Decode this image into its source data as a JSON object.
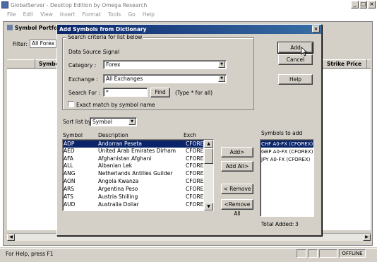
{
  "app": {
    "title": "GlobalServer - Desktop Edition by Omega Research",
    "window_buttons": [
      "_",
      "□",
      "×"
    ]
  },
  "menu": [
    "File",
    "Edit",
    "View",
    "Insert",
    "Format",
    "Tools",
    "Go",
    "Help"
  ],
  "child": {
    "title": "Symbol Portfo",
    "filter_label": "Filter:",
    "filter_value": "All Forex",
    "columns": [
      "Symbo",
      "Strike Price"
    ]
  },
  "dialog": {
    "title": "Add Symbols from Dictionary",
    "close": "×",
    "group_label": "Search criteria for list below",
    "data_source_label": "Data Source :",
    "data_source_value": "Signal",
    "category_label": "Category :",
    "category_value": "Forex",
    "exchange_label": "Exchange :",
    "exchange_value": "All Exchanges",
    "search_label": "Search For :",
    "search_value": "*",
    "find_button": "Find",
    "search_hint": "(Type * for all)",
    "exact_match_label": "Exact match by symbol name",
    "sort_label": "Sort list by",
    "sort_value": "Symbol",
    "list_headers": [
      "Symbol",
      "Description",
      "Exch"
    ],
    "symbols": [
      {
        "symbol": "ADP",
        "description": "Andorran Peseta",
        "exch": "CFOREX"
      },
      {
        "symbol": "AED",
        "description": "United Arab Emirates Dirham",
        "exch": "CFOREX"
      },
      {
        "symbol": "AFA",
        "description": "Afghanistan Afghani",
        "exch": "CFOREX"
      },
      {
        "symbol": "ALL",
        "description": "Albanian Lek",
        "exch": "CFOREX"
      },
      {
        "symbol": "ANG",
        "description": "Netherlands Antilles Guilder",
        "exch": "CFOREX"
      },
      {
        "symbol": "AON",
        "description": "Angola Kwanza",
        "exch": "CFOREX"
      },
      {
        "symbol": "ARS",
        "description": "Argentina Peso",
        "exch": "CFOREX"
      },
      {
        "symbol": "ATS",
        "description": "Austria Shilling",
        "exch": "CFOREX"
      },
      {
        "symbol": "AUD",
        "description": "Australia Dollar",
        "exch": "CFOREX"
      }
    ],
    "add_button": "Add>",
    "add_all_button": "Add All>",
    "remove_button": "< Remove",
    "remove_all_button": "<Remove All",
    "symbols_to_add_label": "Symbols to add",
    "symbols_to_add": [
      "CHF A0-FX (CFOREX)",
      "GBP A0-FX (CFOREX)",
      "JPY A0-FX (CFOREX)"
    ],
    "total_added_label": "Total Added:",
    "total_added_value": "3",
    "ok_button": "Add",
    "cancel_button": "Cancel",
    "help_button": "Help"
  },
  "status": {
    "text": "For Help, press F1",
    "offline": "OFFLINE"
  }
}
